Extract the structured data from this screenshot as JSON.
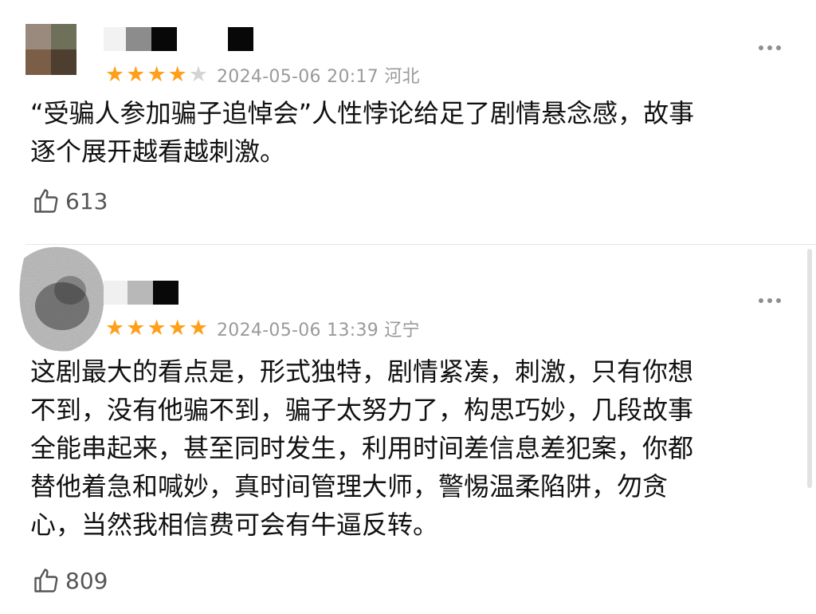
{
  "reviews": [
    {
      "rating": 4,
      "max_rating": 5,
      "date": "2024-05-06 20:17",
      "location": "河北",
      "content": "“受骗人参加骗子追悼会”人性悖论给足了剧情悬念感，故事\n逐个展开越看越刺激。",
      "likes": "613",
      "avatar": "user-avatar",
      "like_icon": "thumbs-up-icon",
      "more_icon": "more-dots-icon"
    },
    {
      "rating": 5,
      "max_rating": 5,
      "date": "2024-05-06 13:39",
      "location": "辽宁",
      "content": "这剧最大的看点是，形式独特，剧情紧凑，刺激，只有你想\n不到，没有他骗不到，骗子太努力了，构思巧妙，几段故事\n全能串起来，甚至同时发生，利用时间差信息差犯案，你都\n替他着急和喊妙，真时间管理大师，警惕温柔陷阱，勿贪\n心，当然我相信费可会有牛逼反转。",
      "likes": "809",
      "avatar": "user-avatar",
      "like_icon": "thumbs-up-icon",
      "more_icon": "more-dots-icon"
    }
  ],
  "colors": {
    "star_on": "#ff9f1a",
    "star_off": "#d4d4d4",
    "meta_text": "#9a9a9a"
  }
}
